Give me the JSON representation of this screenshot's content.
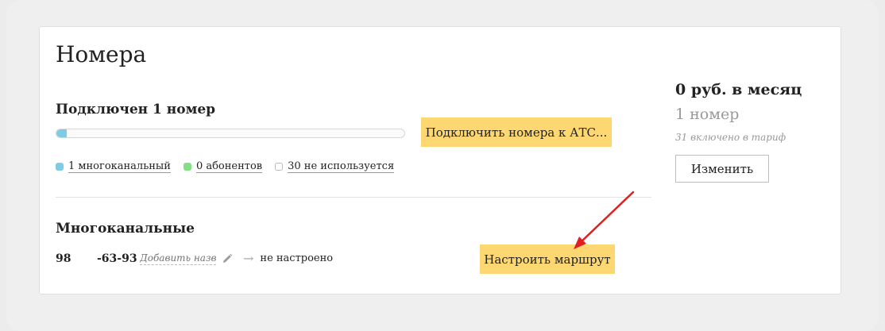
{
  "page": {
    "title": "Номера"
  },
  "summary": {
    "connected_label": "Подключен 1 номер",
    "progress_fraction": 0.03,
    "connect_button": "Подключить номера к АТС...",
    "legend": [
      {
        "label": "1 многоканальный",
        "color": "#7ecbe3"
      },
      {
        "label": "0 абонентов",
        "color": "#84e084"
      },
      {
        "label": "30 не используется",
        "color": "#ffffff"
      }
    ]
  },
  "multichannel": {
    "title": "Многоканальные",
    "number_part1": "98",
    "number_part2": "-63-93",
    "name_placeholder": "Добавить назв...",
    "status": "не настроено",
    "route_button": "Настроить маршрут"
  },
  "tariff": {
    "price": "0 руб. в месяц",
    "count": "1 номер",
    "included": "31 включено в тариф",
    "change_button": "Изменить"
  },
  "colors": {
    "accent_yellow": "#fdd872",
    "annotation_red": "#e02020"
  }
}
